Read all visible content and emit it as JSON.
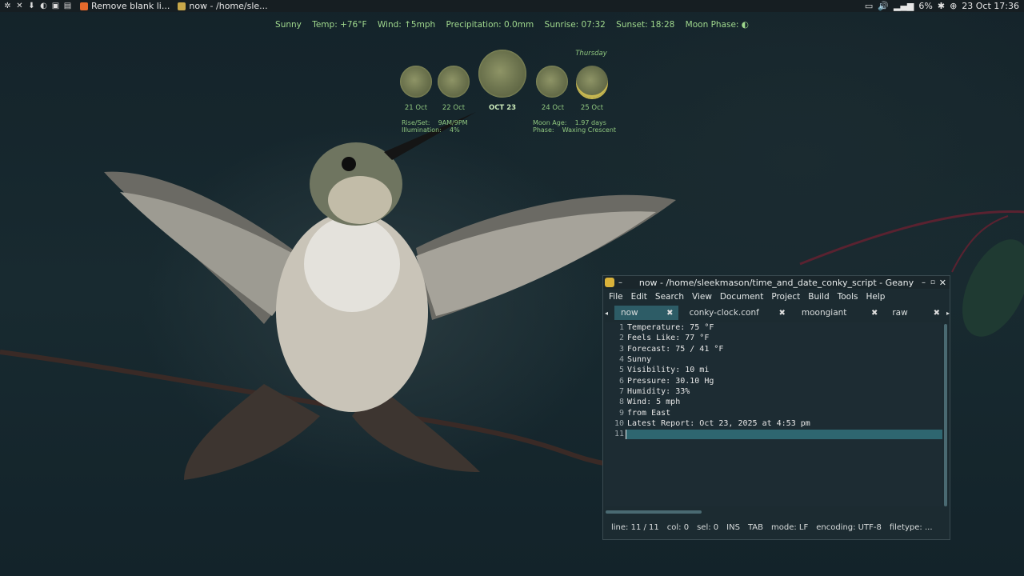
{
  "panel": {
    "tasks": [
      {
        "label": "Remove blank li...",
        "color": "#e66a2c"
      },
      {
        "label": "now - /home/sle...",
        "color": "#c9a84a"
      }
    ],
    "battery": "6%",
    "datetime": "23 Oct 17:36"
  },
  "weather": {
    "items": [
      "Sunny",
      "Temp: +76°F",
      "Wind: ↑5mph",
      "Precipitation: 0.0mm",
      "Sunrise: 07:32",
      "Sunset: 18:28",
      "Moon Phase: ◐"
    ]
  },
  "moon": {
    "weekday": "Thursday",
    "days": [
      "21 Oct",
      "22 Oct",
      "OCT 23",
      "24 Oct",
      "25 Oct"
    ],
    "left_info": "Rise/Set:    9AM/9PM\nIllumination:    4%",
    "right_info": "Moon Age:    1.97 days\nPhase:    Waxing Crescent"
  },
  "window": {
    "title": "now - /home/sleekmason/time_and_date_conky_script - Geany",
    "menu": [
      "File",
      "Edit",
      "Search",
      "View",
      "Document",
      "Project",
      "Build",
      "Tools",
      "Help"
    ],
    "tabs": [
      "now",
      "conky-clock.conf",
      "moongiant",
      "raw"
    ],
    "lines": [
      "Temperature: 75 °F",
      "Feels Like: 77 °F",
      "Forecast: 75 / 41 °F",
      "Sunny",
      "Visibility: 10 mi",
      "Pressure: 30.10 Hg",
      "Humidity: 33%",
      "Wind: 5 mph",
      "from East",
      "Latest Report: Oct 23, 2025 at 4:53 pm",
      ""
    ],
    "line_numbers": [
      "1",
      "2",
      "3",
      "4",
      "5",
      "6",
      "7",
      "8",
      "9",
      "10",
      "11"
    ],
    "status": {
      "line": "line: 11 / 11",
      "col": "col: 0",
      "sel": "sel: 0",
      "ins": "INS",
      "tab": "TAB",
      "mode": "mode: LF",
      "encoding": "encoding: UTF-8",
      "filetype": "filetype: ..."
    }
  }
}
